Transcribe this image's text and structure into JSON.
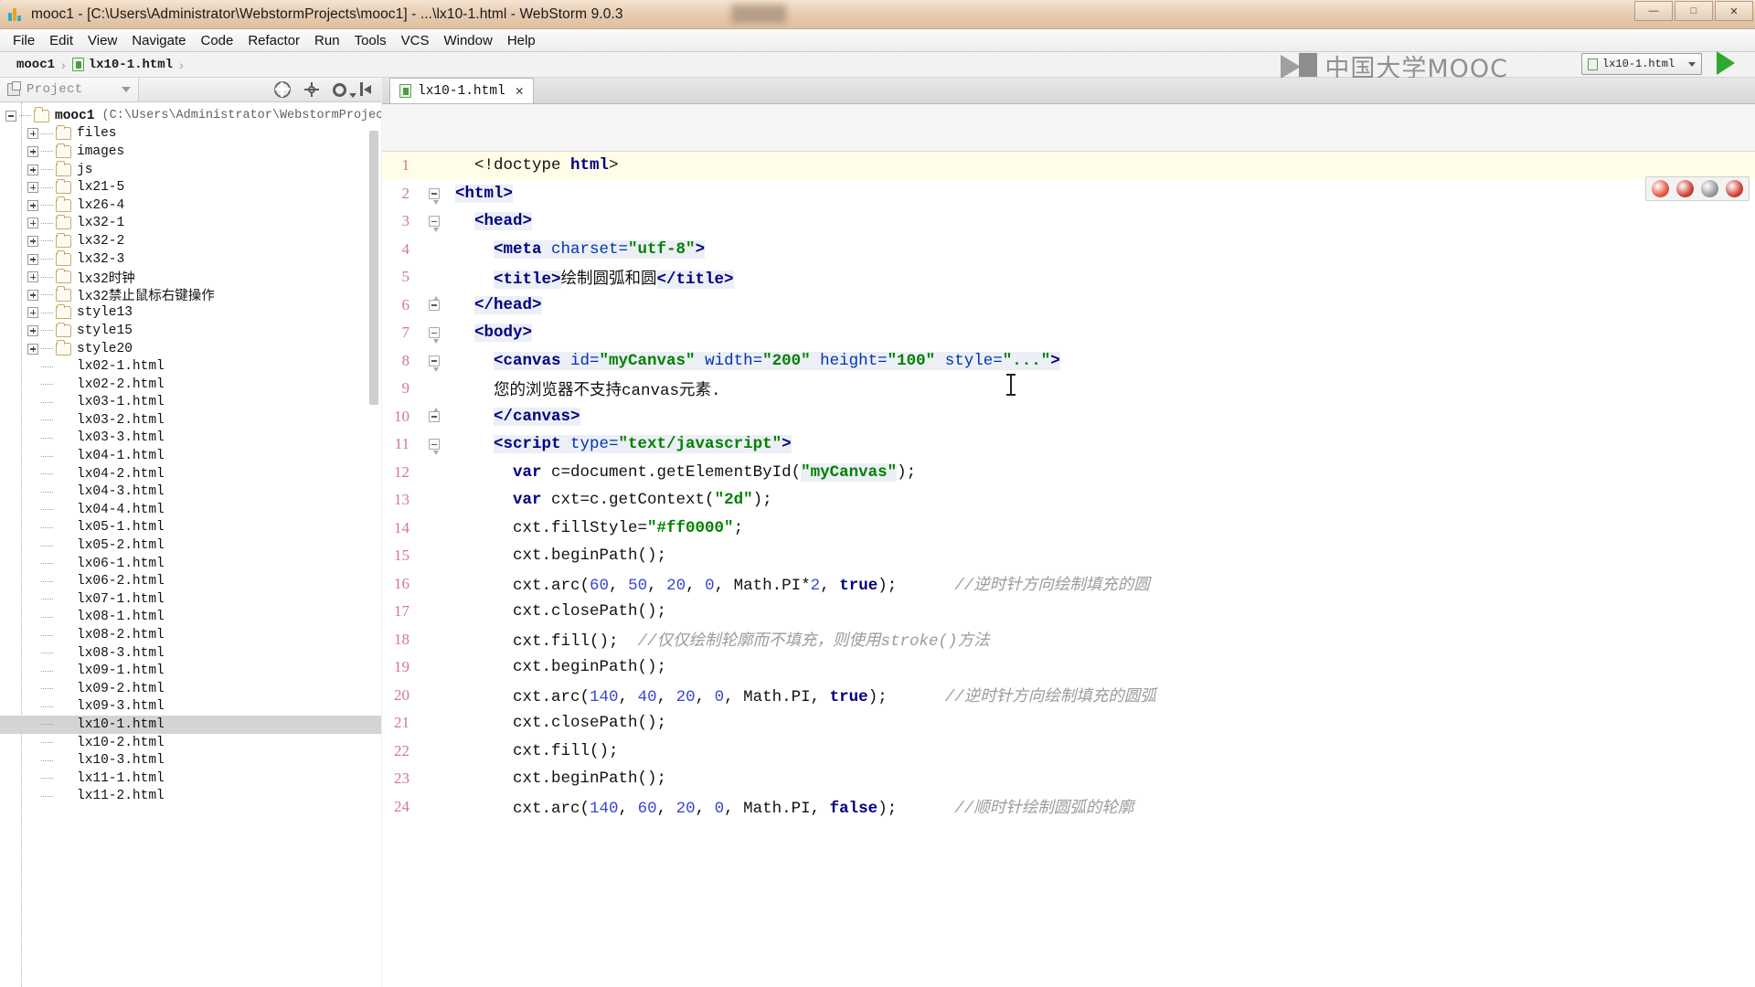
{
  "window": {
    "title": "mooc1 - [C:\\Users\\Administrator\\WebstormProjects\\mooc1] - ...\\lx10-1.html - WebStorm 9.0.3",
    "app_icon": "webstorm-icon",
    "minimize_label": "—",
    "maximize_label": "□",
    "close_label": "✕"
  },
  "menubar": {
    "items": [
      "File",
      "Edit",
      "View",
      "Navigate",
      "Code",
      "Refactor",
      "Run",
      "Tools",
      "VCS",
      "Window",
      "Help"
    ]
  },
  "navbar": {
    "crumbs": [
      "mooc1",
      "lx10-1.html"
    ],
    "separator": "›"
  },
  "watermark": {
    "text": "中国大学MOOC",
    "logo": "book-logo"
  },
  "run_config": {
    "name": "lx10-1.html",
    "caret": "▾",
    "run_label": "Run"
  },
  "project_panel": {
    "tool_window_title": "Project",
    "caret": "▾",
    "tools": [
      "collapse-all-icon",
      "scroll-from-source-icon",
      "settings-icon",
      "hide-icon"
    ],
    "tree": [
      {
        "depth": 0,
        "type": "root",
        "expander": "minus",
        "name": "mooc1",
        "path": "(C:\\Users\\Administrator\\WebstormProjects\\",
        "bold": true
      },
      {
        "depth": 1,
        "type": "folder",
        "expander": "plus",
        "name": "files"
      },
      {
        "depth": 1,
        "type": "folder",
        "expander": "plus",
        "name": "images"
      },
      {
        "depth": 1,
        "type": "folder",
        "expander": "plus",
        "name": "js"
      },
      {
        "depth": 1,
        "type": "folder",
        "expander": "plus",
        "name": "lx21-5"
      },
      {
        "depth": 1,
        "type": "folder",
        "expander": "plus",
        "name": "lx26-4"
      },
      {
        "depth": 1,
        "type": "folder",
        "expander": "plus",
        "name": "lx32-1"
      },
      {
        "depth": 1,
        "type": "folder",
        "expander": "plus",
        "name": "lx32-2"
      },
      {
        "depth": 1,
        "type": "folder",
        "expander": "plus",
        "name": "lx32-3"
      },
      {
        "depth": 1,
        "type": "folder",
        "expander": "plus",
        "name": "lx32时钟"
      },
      {
        "depth": 1,
        "type": "folder",
        "expander": "plus",
        "name": "lx32禁止鼠标右键操作"
      },
      {
        "depth": 1,
        "type": "folder",
        "expander": "plus",
        "name": "style13"
      },
      {
        "depth": 1,
        "type": "folder",
        "expander": "plus",
        "name": "style15"
      },
      {
        "depth": 1,
        "type": "folder",
        "expander": "plus",
        "name": "style20"
      },
      {
        "depth": 1,
        "type": "file",
        "name": "lx02-1.html"
      },
      {
        "depth": 1,
        "type": "file",
        "name": "lx02-2.html"
      },
      {
        "depth": 1,
        "type": "file",
        "name": "lx03-1.html"
      },
      {
        "depth": 1,
        "type": "file",
        "name": "lx03-2.html"
      },
      {
        "depth": 1,
        "type": "file",
        "name": "lx03-3.html"
      },
      {
        "depth": 1,
        "type": "file",
        "name": "lx04-1.html"
      },
      {
        "depth": 1,
        "type": "file",
        "name": "lx04-2.html"
      },
      {
        "depth": 1,
        "type": "file",
        "name": "lx04-3.html"
      },
      {
        "depth": 1,
        "type": "file",
        "name": "lx04-4.html"
      },
      {
        "depth": 1,
        "type": "file",
        "name": "lx05-1.html"
      },
      {
        "depth": 1,
        "type": "file",
        "name": "lx05-2.html"
      },
      {
        "depth": 1,
        "type": "file",
        "name": "lx06-1.html"
      },
      {
        "depth": 1,
        "type": "file",
        "name": "lx06-2.html"
      },
      {
        "depth": 1,
        "type": "file",
        "name": "lx07-1.html"
      },
      {
        "depth": 1,
        "type": "file",
        "name": "lx08-1.html"
      },
      {
        "depth": 1,
        "type": "file",
        "name": "lx08-2.html"
      },
      {
        "depth": 1,
        "type": "file",
        "name": "lx08-3.html"
      },
      {
        "depth": 1,
        "type": "file",
        "name": "lx09-1.html"
      },
      {
        "depth": 1,
        "type": "file",
        "name": "lx09-2.html"
      },
      {
        "depth": 1,
        "type": "file",
        "name": "lx09-3.html"
      },
      {
        "depth": 1,
        "type": "file",
        "name": "lx10-1.html",
        "selected": true
      },
      {
        "depth": 1,
        "type": "file",
        "name": "lx10-2.html"
      },
      {
        "depth": 1,
        "type": "file",
        "name": "lx10-3.html"
      },
      {
        "depth": 1,
        "type": "file",
        "name": "lx11-1.html"
      },
      {
        "depth": 1,
        "type": "file",
        "name": "lx11-2.html"
      }
    ]
  },
  "editor": {
    "tab": {
      "name": "lx10-1.html",
      "close": "✕",
      "icon": "html-file-icon"
    },
    "lines": [
      {
        "n": 1,
        "fold": "none",
        "current": true,
        "tokens": [
          {
            "t": "  <!doctype ",
            "c": "plain"
          },
          {
            "t": "html",
            "c": "tag"
          },
          {
            "t": ">",
            "c": "plain"
          }
        ]
      },
      {
        "n": 2,
        "fold": "ptr",
        "tokens": [
          {
            "t": "<html>",
            "c": "tag",
            "hl": true
          }
        ]
      },
      {
        "n": 3,
        "fold": "ptr",
        "tokens": [
          {
            "t": "  ",
            "c": "plain"
          },
          {
            "t": "<head>",
            "c": "tag",
            "hl": true
          }
        ]
      },
      {
        "n": 4,
        "fold": "none",
        "tokens": [
          {
            "t": "    ",
            "c": "plain"
          },
          {
            "t": "<meta ",
            "c": "tag",
            "hl": true
          },
          {
            "t": "charset=",
            "c": "attr",
            "hl": true
          },
          {
            "t": "\"utf-8\"",
            "c": "str",
            "hl": true
          },
          {
            "t": ">",
            "c": "tag",
            "hl": true
          }
        ]
      },
      {
        "n": 5,
        "fold": "none",
        "tokens": [
          {
            "t": "    ",
            "c": "plain"
          },
          {
            "t": "<title>",
            "c": "tag",
            "hl": true
          },
          {
            "t": "绘制圆弧和圆",
            "c": "plain"
          },
          {
            "t": "</title>",
            "c": "tag",
            "hl": true
          }
        ]
      },
      {
        "n": 6,
        "fold": "end",
        "tokens": [
          {
            "t": "  ",
            "c": "plain"
          },
          {
            "t": "</head>",
            "c": "tag",
            "hl": true
          }
        ]
      },
      {
        "n": 7,
        "fold": "ptr",
        "tokens": [
          {
            "t": "  ",
            "c": "plain"
          },
          {
            "t": "<body>",
            "c": "tag",
            "hl": true
          }
        ]
      },
      {
        "n": 8,
        "fold": "ptr",
        "tokens": [
          {
            "t": "    ",
            "c": "plain"
          },
          {
            "t": "<canvas ",
            "c": "tag",
            "hl": true
          },
          {
            "t": "id=",
            "c": "attr",
            "hl": true
          },
          {
            "t": "\"myCanvas\"",
            "c": "str",
            "hl": true
          },
          {
            "t": " ",
            "c": "plain",
            "hl": true
          },
          {
            "t": "width=",
            "c": "attr",
            "hl": true
          },
          {
            "t": "\"200\"",
            "c": "str",
            "hl": true
          },
          {
            "t": " ",
            "c": "plain",
            "hl": true
          },
          {
            "t": "height=",
            "c": "attr",
            "hl": true
          },
          {
            "t": "\"100\"",
            "c": "str",
            "hl": true
          },
          {
            "t": " ",
            "c": "plain",
            "hl": true
          },
          {
            "t": "style=",
            "c": "attr",
            "hl": true
          },
          {
            "t": "\"...\"",
            "c": "str",
            "hl": true
          },
          {
            "t": ">",
            "c": "tag",
            "hl": true
          }
        ]
      },
      {
        "n": 9,
        "fold": "none",
        "tokens": [
          {
            "t": "    您的浏览器不支持canvas元素.",
            "c": "plain"
          }
        ]
      },
      {
        "n": 10,
        "fold": "end",
        "tokens": [
          {
            "t": "    ",
            "c": "plain"
          },
          {
            "t": "</canvas>",
            "c": "tag",
            "hl": true
          }
        ]
      },
      {
        "n": 11,
        "fold": "ptr",
        "tokens": [
          {
            "t": "    ",
            "c": "plain"
          },
          {
            "t": "<script ",
            "c": "tag",
            "hl": true
          },
          {
            "t": "type=",
            "c": "attr",
            "hl": true
          },
          {
            "t": "\"text/javascript\"",
            "c": "str",
            "hl": true
          },
          {
            "t": ">",
            "c": "tag",
            "hl": true
          }
        ]
      },
      {
        "n": 12,
        "fold": "none",
        "tokens": [
          {
            "t": "      ",
            "c": "plain"
          },
          {
            "t": "var",
            "c": "kw"
          },
          {
            "t": " c=document.getElementById(",
            "c": "plain"
          },
          {
            "t": "\"myCanvas\"",
            "c": "str",
            "hl": true
          },
          {
            "t": ");",
            "c": "plain"
          }
        ]
      },
      {
        "n": 13,
        "fold": "none",
        "tokens": [
          {
            "t": "      ",
            "c": "plain"
          },
          {
            "t": "var",
            "c": "kw"
          },
          {
            "t": " cxt=c.getContext(",
            "c": "plain"
          },
          {
            "t": "\"2d\"",
            "c": "str"
          },
          {
            "t": ");",
            "c": "plain"
          }
        ]
      },
      {
        "n": 14,
        "fold": "none",
        "tokens": [
          {
            "t": "      cxt.fillStyle=",
            "c": "plain"
          },
          {
            "t": "\"#ff0000\"",
            "c": "str"
          },
          {
            "t": ";",
            "c": "plain"
          }
        ]
      },
      {
        "n": 15,
        "fold": "none",
        "tokens": [
          {
            "t": "      cxt.beginPath();",
            "c": "plain"
          }
        ]
      },
      {
        "n": 16,
        "fold": "none",
        "tokens": [
          {
            "t": "      cxt.arc(",
            "c": "plain"
          },
          {
            "t": "60",
            "c": "num"
          },
          {
            "t": ", ",
            "c": "plain"
          },
          {
            "t": "50",
            "c": "num"
          },
          {
            "t": ", ",
            "c": "plain"
          },
          {
            "t": "20",
            "c": "num"
          },
          {
            "t": ", ",
            "c": "plain"
          },
          {
            "t": "0",
            "c": "num"
          },
          {
            "t": ", Math.PI*",
            "c": "plain"
          },
          {
            "t": "2",
            "c": "num"
          },
          {
            "t": ", ",
            "c": "plain"
          },
          {
            "t": "true",
            "c": "kw"
          },
          {
            "t": ");      ",
            "c": "plain"
          },
          {
            "t": "//逆时针方向绘制填充的圆",
            "c": "cmt"
          }
        ]
      },
      {
        "n": 17,
        "fold": "none",
        "tokens": [
          {
            "t": "      cxt.closePath();",
            "c": "plain"
          }
        ]
      },
      {
        "n": 18,
        "fold": "none",
        "tokens": [
          {
            "t": "      cxt.fill();  ",
            "c": "plain"
          },
          {
            "t": "//仅仅绘制轮廓而不填充，则使用stroke()方法",
            "c": "cmt"
          }
        ]
      },
      {
        "n": 19,
        "fold": "none",
        "tokens": [
          {
            "t": "      cxt.beginPath();",
            "c": "plain"
          }
        ]
      },
      {
        "n": 20,
        "fold": "none",
        "tokens": [
          {
            "t": "      cxt.arc(",
            "c": "plain"
          },
          {
            "t": "140",
            "c": "num"
          },
          {
            "t": ", ",
            "c": "plain"
          },
          {
            "t": "40",
            "c": "num"
          },
          {
            "t": ", ",
            "c": "plain"
          },
          {
            "t": "20",
            "c": "num"
          },
          {
            "t": ", ",
            "c": "plain"
          },
          {
            "t": "0",
            "c": "num"
          },
          {
            "t": ", Math.PI, ",
            "c": "plain"
          },
          {
            "t": "true",
            "c": "kw"
          },
          {
            "t": ");      ",
            "c": "plain"
          },
          {
            "t": "//逆时针方向绘制填充的圆弧",
            "c": "cmt"
          }
        ]
      },
      {
        "n": 21,
        "fold": "none",
        "tokens": [
          {
            "t": "      cxt.closePath();",
            "c": "plain"
          }
        ]
      },
      {
        "n": 22,
        "fold": "none",
        "tokens": [
          {
            "t": "      cxt.fill();",
            "c": "plain"
          }
        ]
      },
      {
        "n": 23,
        "fold": "none",
        "tokens": [
          {
            "t": "      cxt.beginPath();",
            "c": "plain"
          }
        ]
      },
      {
        "n": 24,
        "fold": "none",
        "tokens": [
          {
            "t": "      cxt.arc(",
            "c": "plain"
          },
          {
            "t": "140",
            "c": "num"
          },
          {
            "t": ", ",
            "c": "plain"
          },
          {
            "t": "60",
            "c": "num"
          },
          {
            "t": ", ",
            "c": "plain"
          },
          {
            "t": "20",
            "c": "num"
          },
          {
            "t": ", ",
            "c": "plain"
          },
          {
            "t": "0",
            "c": "num"
          },
          {
            "t": ", Math.PI, ",
            "c": "plain"
          },
          {
            "t": "false",
            "c": "kw"
          },
          {
            "t": ");      ",
            "c": "plain"
          },
          {
            "t": "//顺时针绘制圆弧的轮廓",
            "c": "cmt"
          }
        ]
      }
    ],
    "inspection_badges": [
      "error-badge",
      "error-badge",
      "neutral-badge",
      "error-badge"
    ]
  }
}
